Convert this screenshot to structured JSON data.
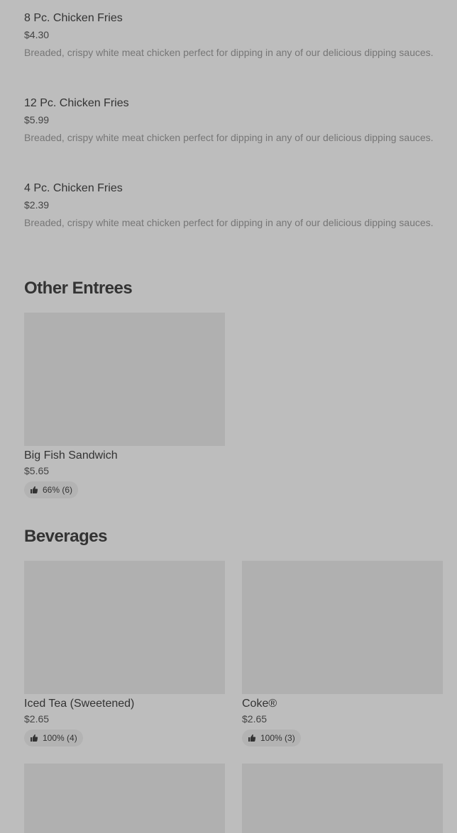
{
  "items": [
    {
      "name": "8 Pc. Chicken Fries",
      "price": "$4.30",
      "desc": "Breaded, crispy white meat chicken perfect for dipping in any of our delicious dipping sauces."
    },
    {
      "name": "12 Pc. Chicken Fries",
      "price": "$5.99",
      "desc": "Breaded, crispy white meat chicken perfect for dipping in any of our delicious dipping sauces."
    },
    {
      "name": "4 Pc. Chicken Fries",
      "price": "$2.39",
      "desc": "Breaded, crispy white meat chicken perfect for dipping in any of our delicious dipping sauces."
    }
  ],
  "sections": {
    "other_entrees": {
      "title": "Other Entrees",
      "cards": [
        {
          "name": "Big Fish Sandwich",
          "price": "$5.65",
          "rating": "66% (6)"
        }
      ]
    },
    "beverages": {
      "title": "Beverages",
      "cards": [
        {
          "name": "Iced Tea (Sweetened)",
          "price": "$2.65",
          "rating": "100% (4)"
        },
        {
          "name": "Coke®",
          "price": "$2.65",
          "rating": "100% (3)"
        }
      ]
    }
  },
  "icons": {
    "rating": "thumbs-up-icon"
  },
  "colors": {
    "background": "#bdbdbd",
    "placeholder": "#b0b0b0",
    "badge": "#b3b3b3"
  }
}
